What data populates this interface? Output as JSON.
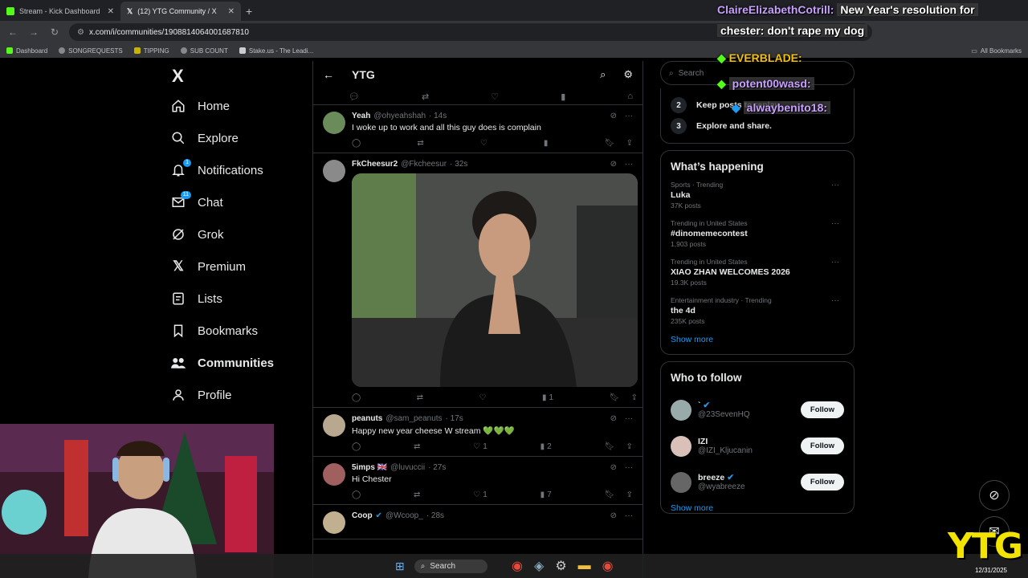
{
  "browser": {
    "tabs": [
      {
        "label": "Stream - Kick Dashboard",
        "color": "#53fc18"
      },
      {
        "label": "(12) YTG Community / X",
        "color": "#ffffff"
      }
    ],
    "url": "x.com/i/communities/1908814064001687810",
    "bookmarks": [
      "Dashboard",
      "SONGREQUESTS",
      "TIPPING",
      "SUB COUNT",
      "Stake.us - The Leadi..."
    ],
    "all_bookmarks": "All Bookmarks"
  },
  "nav": {
    "logo": "X",
    "items": [
      {
        "label": "Home",
        "icon": "home-icon"
      },
      {
        "label": "Explore",
        "icon": "search-icon"
      },
      {
        "label": "Notifications",
        "icon": "bell-icon",
        "badge": "1"
      },
      {
        "label": "Chat",
        "icon": "mail-icon",
        "badge": "11"
      },
      {
        "label": "Grok",
        "icon": "grok-icon"
      },
      {
        "label": "Premium",
        "icon": "x-icon"
      },
      {
        "label": "Lists",
        "icon": "list-icon"
      },
      {
        "label": "Bookmarks",
        "icon": "bookmark-icon"
      },
      {
        "label": "Communities",
        "icon": "people-icon"
      },
      {
        "label": "Profile",
        "icon": "user-icon"
      }
    ]
  },
  "community": {
    "title": "YTG"
  },
  "posts": [
    {
      "name": "Yeah",
      "handle": "@ohyeahshah",
      "time": "· 14s",
      "text": "I woke up to work and all this guy does is complain",
      "likes": "",
      "views": "",
      "avatar": "#6a8c5a"
    },
    {
      "name": "FkCheesur2",
      "handle": "@Fkcheesur",
      "time": "· 32s",
      "text": "",
      "likes": "",
      "views": "1",
      "avatar": "#8a8a8a"
    },
    {
      "name": "peanuts",
      "handle": "@sam_peanuts",
      "time": "· 17s",
      "text": "Happy new year cheese W stream 💚💚💚",
      "likes": "1",
      "views": "2",
      "avatar": "#b8a890"
    },
    {
      "name": "5imps 🇬🇧",
      "handle": "@luvuccii",
      "time": "· 27s",
      "text": "Hi Chester",
      "likes": "1",
      "views": "7",
      "avatar": "#a06060"
    },
    {
      "name": "Coop",
      "handle": "@Wcoop_",
      "time": "· 28s",
      "text": "",
      "likes": "",
      "views": "",
      "avatar": "#c0b090"
    }
  ],
  "right": {
    "search_placeholder": "Search",
    "steps": [
      {
        "n": "2",
        "label": "Keep posts to replay"
      },
      {
        "n": "3",
        "label": "Explore and share."
      }
    ],
    "happening_title": "What’s happening",
    "trends": [
      {
        "cat": "Sports · Trending",
        "title": "Luka",
        "count": "37K posts"
      },
      {
        "cat": "Trending in United States",
        "title": "#dinomemecontest",
        "count": "1,903 posts"
      },
      {
        "cat": "Trending in United States",
        "title": "XIAO ZHAN WELCOMES 2026",
        "count": "19.3K posts"
      },
      {
        "cat": "Entertainment industry · Trending",
        "title": "the 4d",
        "count": "235K posts"
      }
    ],
    "show_more": "Show more",
    "wtf_title": "Who to follow",
    "who_to_follow": [
      {
        "name": "`",
        "handle": "@23SevenHQ",
        "avatar": "#9aa"
      },
      {
        "name": "IZI",
        "handle": "@IZI_Kljucanin",
        "avatar": "#d9c0b8"
      },
      {
        "name": "breeze",
        "handle": "@wyabreeze",
        "avatar": "#666"
      }
    ],
    "follow_label": "Follow",
    "show_more_2": "Show more"
  },
  "chat_overlay": [
    {
      "user": "ClaireElizabethCotrill:",
      "msg": "New Year's resolution for"
    },
    {
      "user": "",
      "msg": "chester: don't rape my dog"
    },
    {
      "user": "EVERBLADE:",
      "msg": ""
    },
    {
      "user": "potent00wasd:",
      "msg": ""
    },
    {
      "user": "alwaybenito18:",
      "msg": ""
    }
  ],
  "taskbar": {
    "search": "Search",
    "date": "12/31/2025"
  },
  "watermark": "YTG"
}
